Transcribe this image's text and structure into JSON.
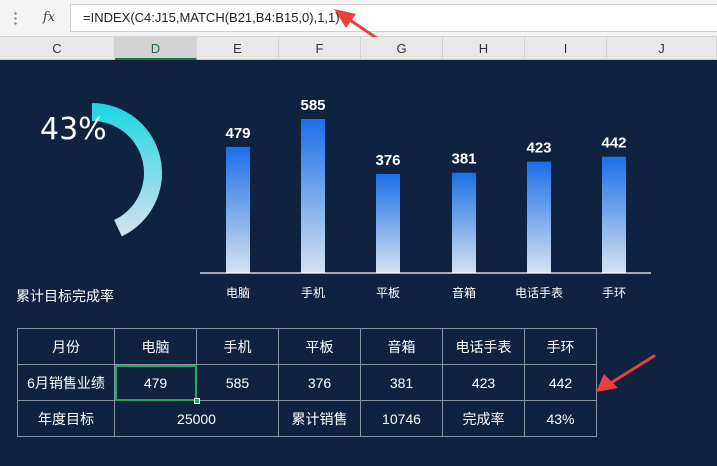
{
  "formula_bar": {
    "fx_label": "fx",
    "formula": "=INDEX(C4:J15,MATCH(B21,B4:B15,0),1,1)"
  },
  "columns": [
    {
      "label": "C"
    },
    {
      "label": "D"
    },
    {
      "label": "E"
    },
    {
      "label": "F"
    },
    {
      "label": "G"
    },
    {
      "label": "H"
    },
    {
      "label": "I"
    },
    {
      "label": "J"
    }
  ],
  "selected_column": "D",
  "gauge": {
    "percent": 43,
    "label": "43%",
    "caption": "累计目标完成率"
  },
  "chart_data": {
    "type": "bar",
    "categories": [
      "电脑",
      "手机",
      "平板",
      "音箱",
      "电话手表",
      "手环"
    ],
    "values": [
      479,
      585,
      376,
      381,
      423,
      442
    ],
    "data_labels": [
      "479",
      "585",
      "376",
      "381",
      "423",
      "442"
    ],
    "ylim": [
      0,
      650
    ],
    "grid": false,
    "colors": {
      "bar_top": "#1a6fe8",
      "bar_bottom": "#d6e2f0",
      "axis": "#ffffff"
    }
  },
  "table": {
    "header": [
      "月份",
      "电脑",
      "手机",
      "平板",
      "音箱",
      "电话手表",
      "手环"
    ],
    "sales_row": [
      "6月销售业绩",
      "479",
      "585",
      "376",
      "381",
      "423",
      "442"
    ],
    "summary_row": {
      "target_label": "年度目标",
      "target_value": "25000",
      "cumulative_label": "累计销售",
      "cumulative_value": "10746",
      "rate_label": "完成率",
      "rate_value": "43%"
    }
  },
  "colors": {
    "dashboard_bg": "#0f2341",
    "gauge_start": "#19d6e0",
    "gauge_end": "#d6e2f0",
    "annotation_arrow": "#e8413c",
    "selection": "#2aa860"
  }
}
